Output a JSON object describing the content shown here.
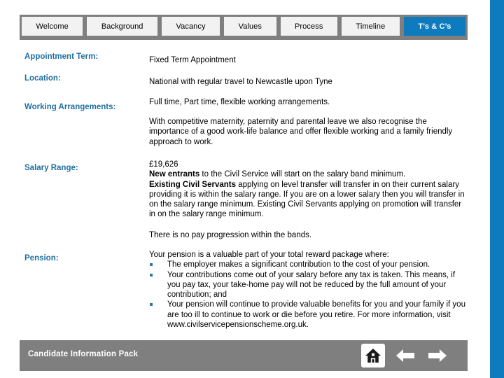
{
  "slide": {
    "right_strip_color": "#0D7BBE",
    "bar_color": "#7F7F7F",
    "label_color": "#1F6FA3",
    "active_tab_color": "#0D7BBE"
  },
  "tabs": [
    {
      "label": "Welcome",
      "active": false
    },
    {
      "label": "Background",
      "active": false
    },
    {
      "label": "Vacancy",
      "active": false
    },
    {
      "label": "Values",
      "active": false
    },
    {
      "label": "Process",
      "active": false
    },
    {
      "label": "Timeline",
      "active": false
    },
    {
      "label": "T’s & C’s",
      "active": true
    }
  ],
  "rows": {
    "appointment_term": {
      "label": "Appointment Term:",
      "value": "Fixed Term Appointment"
    },
    "location": {
      "label": "Location:",
      "value": "National with regular travel to Newcastle upon Tyne"
    },
    "working_arrangements": {
      "label": "Working Arrangements:",
      "value": "Full time, Part time, flexible working arrangements.",
      "note": "With competitive maternity, paternity and parental leave we also recognise the importance of a good work-life balance and offer flexible working and a family friendly approach to work."
    },
    "salary_range": {
      "label": "Salary Range:",
      "amount": "£19,626",
      "new_entrants_bold": "New entrants",
      "new_entrants_rest": " to the Civil Service will start on the salary band minimum.",
      "existing_bold": "Existing Civil Servants",
      "existing_rest": " applying on level transfer will transfer in on their current salary providing it is within the salary range. If you are on a lower salary then you will transfer in on the salary range minimum. Existing Civil Servants applying on promotion will transfer in on the salary range minimum.",
      "no_progression": "There is no pay progression within the bands."
    },
    "pension": {
      "label": "Pension:",
      "intro": "Your pension is a valuable part of your total reward package where:",
      "bullets": [
        "The employer makes a significant contribution to the cost of your pension.",
        "Your contributions come out of your salary before any tax is taken. This means, if you pay tax, your take-home pay will not be reduced by the full amount of your contribution; and",
        "Your pension will continue to provide valuable benefits for you and your family if you are too ill to continue to work or die before you retire. For more information, visit www.civilservicepensionscheme.org.uk."
      ]
    }
  },
  "footer": {
    "title": "Candidate Information Pack",
    "icons": {
      "home": "home-icon",
      "previous": "arrow-left-icon",
      "next": "arrow-right-icon"
    }
  }
}
